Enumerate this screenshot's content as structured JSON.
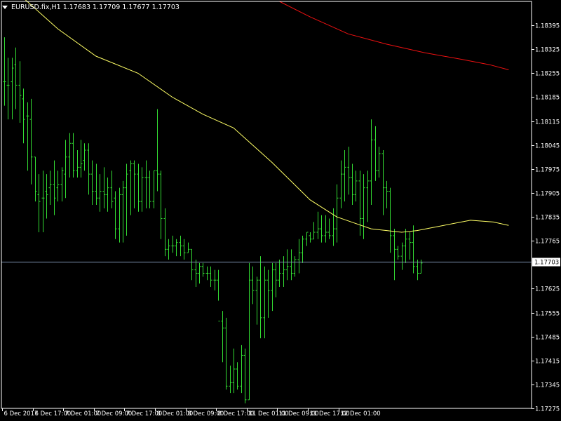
{
  "header": {
    "symbol_label": "EURUSD.fix,H1",
    "ohlc_label": "1.17683 1.17709 1.17677 1.17703"
  },
  "colors": {
    "background": "#000000",
    "bar": "#33dd33",
    "frame": "#ffffff",
    "ma_fast": "#ffff66",
    "ma_slow": "#ee1111",
    "bid_line": "#7f95b4",
    "current_price_label_bg": "#ffffff"
  },
  "chart_data": {
    "type": "ohlc",
    "symbol": "EURUSD.fix",
    "timeframe": "H1",
    "ylim": [
      1.17275,
      1.18465
    ],
    "grid": false,
    "y_ticks": [
      "1.18395",
      "1.18325",
      "1.18255",
      "1.18185",
      "1.18115",
      "1.18045",
      "1.17975",
      "1.17905",
      "1.17835",
      "1.17765",
      "1.17625",
      "1.17555",
      "1.17485",
      "1.17415",
      "1.17345",
      "1.17275"
    ],
    "x_ticks": [
      "6 Dec 2017",
      "6 Dec 17:00",
      "7 Dec 01:00",
      "7 Dec 09:00",
      "7 Dec 17:00",
      "8 Dec 01:00",
      "8 Dec 09:00",
      "8 Dec 17:00",
      "11 Dec 01:00",
      "11 Dec 09:00",
      "11 Dec 17:00",
      "12 Dec 01:00"
    ],
    "current_price": "1.17703",
    "bars": [
      [
        1.1823,
        1.1836,
        1.1816,
        1.1823
      ],
      [
        1.1822,
        1.183,
        1.1812,
        1.1822
      ],
      [
        1.1823,
        1.183,
        1.1812,
        1.1827
      ],
      [
        1.1828,
        1.1833,
        1.1815,
        1.1822
      ],
      [
        1.1822,
        1.1829,
        1.1811,
        1.1819
      ],
      [
        1.1818,
        1.1821,
        1.1805,
        1.1812
      ],
      [
        1.1813,
        1.1817,
        1.1797,
        1.1813
      ],
      [
        1.1812,
        1.1818,
        1.1793,
        1.1801
      ],
      [
        1.1801,
        1.1801,
        1.1788,
        1.1791
      ],
      [
        1.179,
        1.1796,
        1.1779,
        1.1788
      ],
      [
        1.1789,
        1.1797,
        1.1779,
        1.1789
      ],
      [
        1.1791,
        1.1796,
        1.1783,
        1.179
      ],
      [
        1.1792,
        1.1797,
        1.1787,
        1.1793
      ],
      [
        1.1793,
        1.18,
        1.1784,
        1.1789
      ],
      [
        1.1792,
        1.1797,
        1.1788,
        1.1793
      ],
      [
        1.1793,
        1.1798,
        1.1788,
        1.1797
      ],
      [
        1.1796,
        1.1806,
        1.1789,
        1.1801
      ],
      [
        1.1801,
        1.1808,
        1.1795,
        1.1805
      ],
      [
        1.1805,
        1.1808,
        1.1795,
        1.1797
      ],
      [
        1.1797,
        1.1803,
        1.1795,
        1.1798
      ],
      [
        1.1798,
        1.1806,
        1.1795,
        1.1799
      ],
      [
        1.18,
        1.1805,
        1.1797,
        1.1803
      ],
      [
        1.1803,
        1.1805,
        1.179,
        1.1796
      ],
      [
        1.1796,
        1.18,
        1.1787,
        1.1791
      ],
      [
        1.1791,
        1.1799,
        1.1787,
        1.1789
      ],
      [
        1.1789,
        1.1796,
        1.1785,
        1.1791
      ],
      [
        1.1791,
        1.1798,
        1.1786,
        1.179
      ],
      [
        1.179,
        1.1795,
        1.1785,
        1.1792
      ],
      [
        1.1792,
        1.1797,
        1.1786,
        1.1788
      ],
      [
        1.1789,
        1.1791,
        1.1777,
        1.178
      ],
      [
        1.178,
        1.1792,
        1.1776,
        1.179
      ],
      [
        1.179,
        1.1794,
        1.1776,
        1.1792
      ],
      [
        1.1792,
        1.1799,
        1.1778,
        1.1796
      ],
      [
        1.1797,
        1.18,
        1.1784,
        1.1799
      ],
      [
        1.1799,
        1.18,
        1.1786,
        1.1796
      ],
      [
        1.1796,
        1.1799,
        1.1785,
        1.1788
      ],
      [
        1.1788,
        1.1798,
        1.1785,
        1.1795
      ],
      [
        1.1795,
        1.18,
        1.1786,
        1.1795
      ],
      [
        1.1795,
        1.1797,
        1.1786,
        1.1788
      ],
      [
        1.1788,
        1.1797,
        1.1786,
        1.1797
      ],
      [
        1.1797,
        1.1815,
        1.1791,
        1.1796
      ],
      [
        1.1796,
        1.1797,
        1.1777,
        1.1783
      ],
      [
        1.1783,
        1.1786,
        1.1772,
        1.1774
      ],
      [
        1.1774,
        1.1777,
        1.1771,
        1.1775
      ],
      [
        1.1775,
        1.1778,
        1.1773,
        1.1775
      ],
      [
        1.1775,
        1.1777,
        1.1772,
        1.1776
      ],
      [
        1.1776,
        1.1778,
        1.1772,
        1.1775
      ],
      [
        1.1775,
        1.1777,
        1.1771,
        1.1773
      ],
      [
        1.1773,
        1.1776,
        1.1773,
        1.1774
      ],
      [
        1.1774,
        1.1774,
        1.1765,
        1.1768
      ],
      [
        1.1768,
        1.1771,
        1.1763,
        1.1767
      ],
      [
        1.1767,
        1.177,
        1.1764,
        1.1769
      ],
      [
        1.1769,
        1.177,
        1.1766,
        1.1767
      ],
      [
        1.1767,
        1.1769,
        1.1765,
        1.1767
      ],
      [
        1.1767,
        1.1769,
        1.1763,
        1.1765
      ],
      [
        1.1765,
        1.1768,
        1.1762,
        1.1765
      ],
      [
        1.1765,
        1.1768,
        1.1759,
        1.1753
      ],
      [
        1.1753,
        1.1756,
        1.1741,
        1.1751
      ],
      [
        1.1751,
        1.1754,
        1.1733,
        1.1734
      ],
      [
        1.1734,
        1.174,
        1.1732,
        1.1735
      ],
      [
        1.1735,
        1.1745,
        1.1732,
        1.1739
      ],
      [
        1.1739,
        1.1741,
        1.1733,
        1.1734
      ],
      [
        1.1734,
        1.1746,
        1.1732,
        1.1743
      ],
      [
        1.1743,
        1.1745,
        1.1729,
        1.173
      ],
      [
        1.173,
        1.177,
        1.173,
        1.1765
      ],
      [
        1.1765,
        1.1769,
        1.1758,
        1.1762
      ],
      [
        1.1762,
        1.1766,
        1.1752,
        1.1765
      ],
      [
        1.1765,
        1.1772,
        1.1748,
        1.1754
      ],
      [
        1.1754,
        1.1769,
        1.1748,
        1.1765
      ],
      [
        1.1765,
        1.1768,
        1.1754,
        1.1762
      ],
      [
        1.1762,
        1.177,
        1.1756,
        1.1768
      ],
      [
        1.1768,
        1.177,
        1.176,
        1.1765
      ],
      [
        1.1765,
        1.1771,
        1.1763,
        1.1767
      ],
      [
        1.1767,
        1.1772,
        1.1763,
        1.1768
      ],
      [
        1.1768,
        1.1774,
        1.1765,
        1.1769
      ],
      [
        1.1769,
        1.1774,
        1.1765,
        1.1767
      ],
      [
        1.1767,
        1.1772,
        1.1766,
        1.1771
      ],
      [
        1.1771,
        1.1777,
        1.1767,
        1.1773
      ],
      [
        1.1773,
        1.1778,
        1.177,
        1.1777
      ],
      [
        1.1777,
        1.1779,
        1.1775,
        1.1779
      ],
      [
        1.1778,
        1.1779,
        1.1776,
        1.1777
      ],
      [
        1.1777,
        1.1782,
        1.1777,
        1.1779
      ],
      [
        1.1779,
        1.1785,
        1.1777,
        1.178
      ],
      [
        1.178,
        1.1784,
        1.1776,
        1.1778
      ],
      [
        1.1778,
        1.1784,
        1.1776,
        1.1779
      ],
      [
        1.1779,
        1.1783,
        1.1777,
        1.1778
      ],
      [
        1.1778,
        1.1786,
        1.1775,
        1.178
      ],
      [
        1.178,
        1.1793,
        1.1776,
        1.1789
      ],
      [
        1.1789,
        1.18,
        1.1786,
        1.1796
      ],
      [
        1.1796,
        1.1803,
        1.1788,
        1.1798
      ],
      [
        1.1798,
        1.1804,
        1.179,
        1.1795
      ],
      [
        1.1795,
        1.1799,
        1.1787,
        1.179
      ],
      [
        1.179,
        1.1797,
        1.1788,
        1.1794
      ],
      [
        1.1794,
        1.1797,
        1.1778,
        1.1783
      ],
      [
        1.1783,
        1.1796,
        1.1777,
        1.1792
      ],
      [
        1.1792,
        1.1797,
        1.1782,
        1.1794
      ],
      [
        1.1794,
        1.1812,
        1.1787,
        1.1806
      ],
      [
        1.1806,
        1.181,
        1.1794,
        1.1797
      ],
      [
        1.1797,
        1.1804,
        1.1795,
        1.1802
      ],
      [
        1.1802,
        1.1803,
        1.1784,
        1.1792
      ],
      [
        1.1792,
        1.1794,
        1.1786,
        1.1791
      ],
      [
        1.1791,
        1.1792,
        1.1773,
        1.1778
      ],
      [
        1.1778,
        1.178,
        1.1765,
        1.1774
      ],
      [
        1.1774,
        1.1775,
        1.1771,
        1.1772
      ],
      [
        1.1772,
        1.1776,
        1.1768,
        1.1775
      ],
      [
        1.1775,
        1.178,
        1.177,
        1.1777
      ],
      [
        1.1777,
        1.1779,
        1.1771,
        1.1776
      ],
      [
        1.1776,
        1.1781,
        1.1767,
        1.1769
      ],
      [
        1.1769,
        1.1771,
        1.1765,
        1.1767
      ],
      [
        1.1767,
        1.1771,
        1.1767,
        1.177
      ]
    ],
    "ma_fast_points": [
      [
        0,
        1.18525
      ],
      [
        6,
        1.18465
      ],
      [
        14,
        1.18385
      ],
      [
        24,
        1.18305
      ],
      [
        35,
        1.18255
      ],
      [
        44,
        1.18185
      ],
      [
        52,
        1.18135
      ],
      [
        60,
        1.18095
      ],
      [
        70,
        1.17995
      ],
      [
        80,
        1.17885
      ],
      [
        87,
        1.17835
      ],
      [
        96,
        1.178
      ],
      [
        104,
        1.1779
      ],
      [
        108,
        1.17795
      ],
      [
        115,
        1.1781
      ],
      [
        122,
        1.17825
      ],
      [
        128,
        1.1782
      ],
      [
        132,
        1.1781
      ]
    ],
    "ma_slow_points": [
      [
        72,
        1.18465
      ],
      [
        80,
        1.1842
      ],
      [
        90,
        1.1837
      ],
      [
        100,
        1.1834
      ],
      [
        110,
        1.18315
      ],
      [
        120,
        1.18295
      ],
      [
        127,
        1.1828
      ],
      [
        132,
        1.18265
      ]
    ]
  }
}
